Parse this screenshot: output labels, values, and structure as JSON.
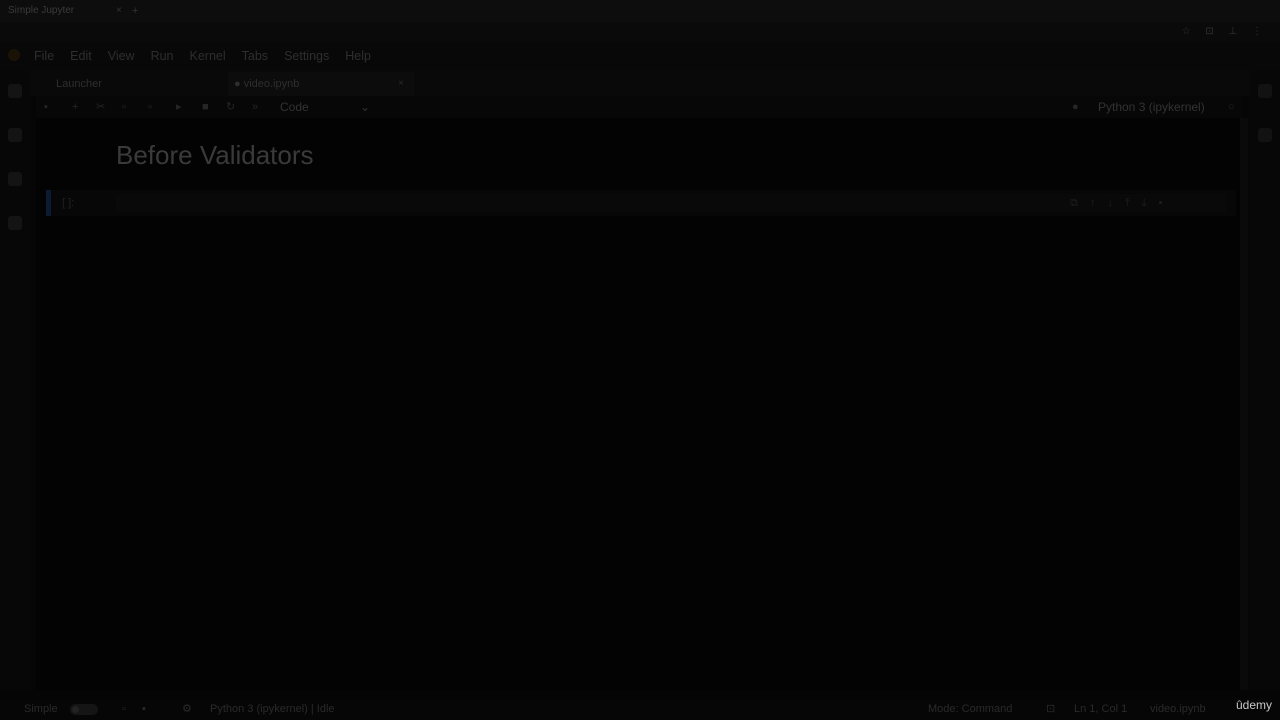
{
  "browser": {
    "tab_title": "Simple Jupyter",
    "tab_close": "×",
    "new_tab": "+",
    "window_controls": "☆ ⊡ ⊥ ⋮"
  },
  "menu": [
    "File",
    "Edit",
    "View",
    "Run",
    "Kernel",
    "Tabs",
    "Settings",
    "Help"
  ],
  "doc_tabs": [
    {
      "label": "Launcher",
      "close": "×"
    },
    {
      "label": "● video.ipynb",
      "close": "×"
    }
  ],
  "toolbar": {
    "cell_type": "Code",
    "cell_type_chevron": "⌄",
    "kernel_name": "Python 3 (ipykernel)"
  },
  "notebook": {
    "heading": "Before Validators",
    "cell_prompt": "[ ]:"
  },
  "status": {
    "simple_label": "Simple",
    "kernel_status": "Python 3 (ipykernel) | Idle",
    "mode": "Mode: Command",
    "position": "Ln 1, Col 1",
    "file": "video.ipynb"
  },
  "watermark": "ûdemy",
  "colors": {
    "background": "#050505",
    "cell_marker": "#0c1a33",
    "watermark": "#c8c8c8"
  }
}
